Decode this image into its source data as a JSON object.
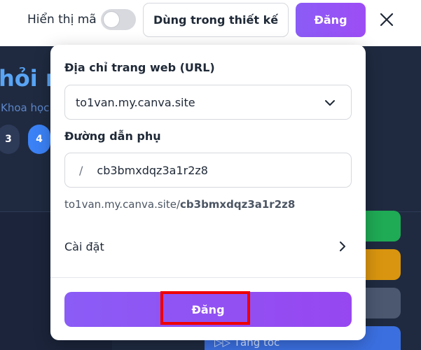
{
  "topbar": {
    "code_label": "Hiển thị mã",
    "use_in_design_label": "Dùng trong thiết kế",
    "publish_label": "Đăng"
  },
  "background": {
    "title_fragment": "hỏi n",
    "subtitle_fragment": "Khoa học",
    "pills": [
      "3",
      "4"
    ],
    "speed_label": "Tăng tốc"
  },
  "popover": {
    "url_label": "Địa chỉ trang web (URL)",
    "url_value": "to1van.my.canva.site",
    "subpath_label": "Đường dẫn phụ",
    "subpath_slash": "/",
    "subpath_value": "cb3bmxdqz3a1r2z8",
    "full_url_domain": "to1van.my.canva.site/",
    "full_url_path": "cb3bmxdqz3a1r2z8",
    "settings_label": "Cài đặt",
    "publish_button_label": "Đăng"
  },
  "colors": {
    "accent_purple": "#8b5cf6",
    "canvas_dark": "#1f2a40",
    "highlight_red": "#ef0000"
  },
  "icons": {
    "close": "close-icon",
    "dropdown": "chevron-down-icon",
    "settings_chevron": "chevron-right-icon"
  }
}
